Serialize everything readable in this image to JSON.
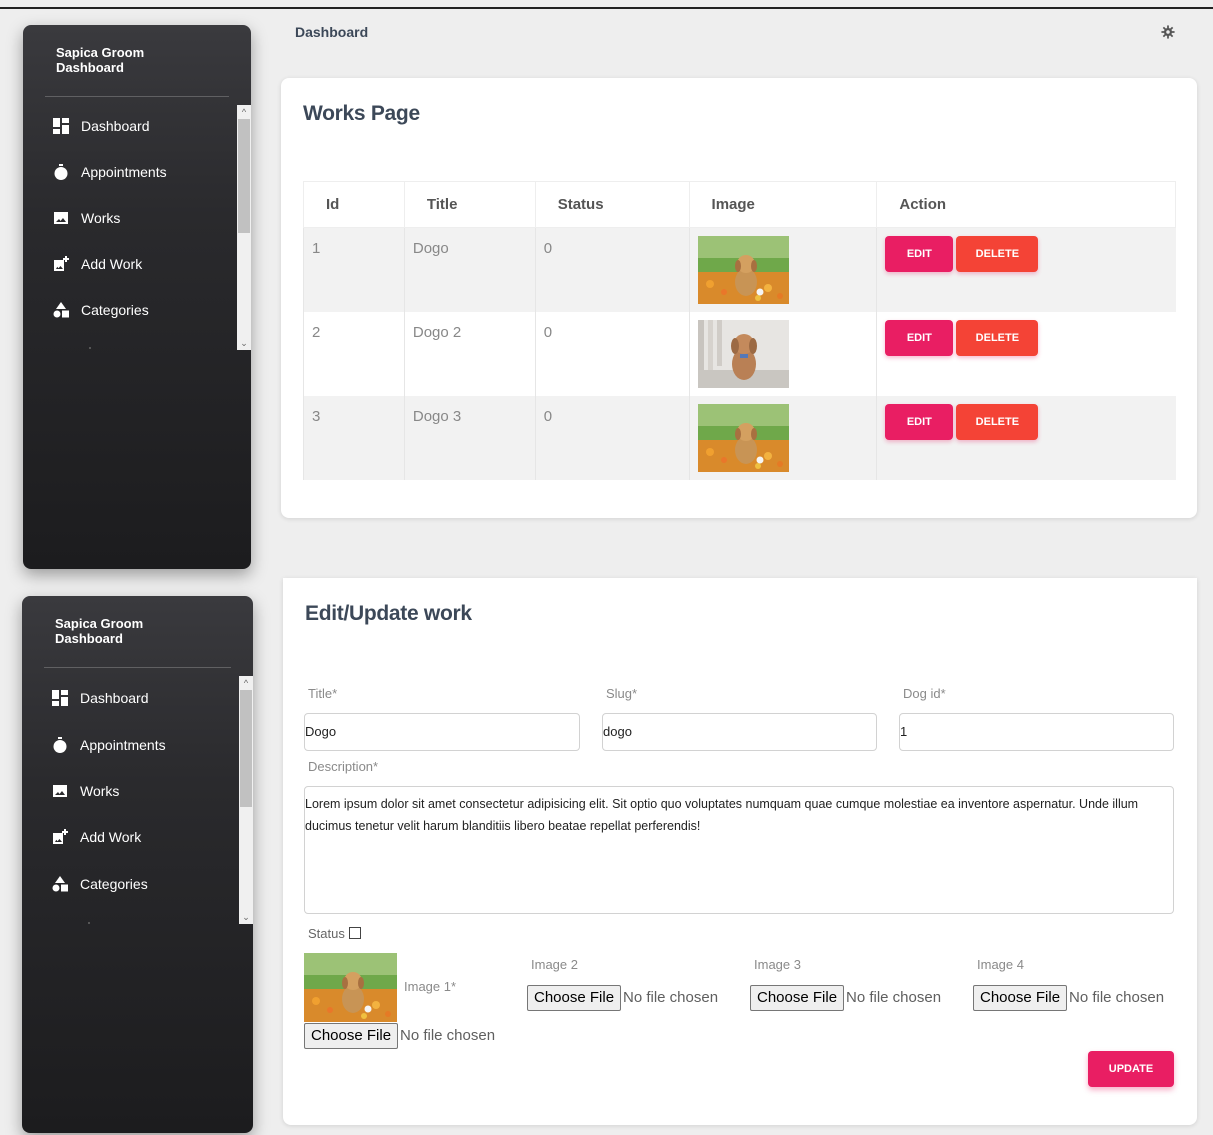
{
  "sidebar": {
    "brand_line1": "Sapica Groom",
    "brand_line2": "Dashboard",
    "items": [
      {
        "label": "Dashboard",
        "icon": "dashboard-icon"
      },
      {
        "label": "Appointments",
        "icon": "stopwatch-icon"
      },
      {
        "label": "Works",
        "icon": "image-icon"
      },
      {
        "label": "Add Work",
        "icon": "add-photo-icon"
      },
      {
        "label": "Categories",
        "icon": "category-icon"
      }
    ]
  },
  "header": {
    "title": "Dashboard",
    "settings_icon": "gear-icon"
  },
  "works_page": {
    "title": "Works Page",
    "columns": [
      "Id",
      "Title",
      "Status",
      "Image",
      "Action"
    ],
    "rows": [
      {
        "id": "1",
        "title": "Dogo",
        "status": "0",
        "image": "dog-in-field-photo"
      },
      {
        "id": "2",
        "title": "Dogo 2",
        "status": "0",
        "image": "dog-on-porch-photo"
      },
      {
        "id": "3",
        "title": "Dogo 3",
        "status": "0",
        "image": "dog-in-field-photo"
      }
    ],
    "edit_label": "EDIT",
    "delete_label": "DELETE"
  },
  "edit_form": {
    "title": "Edit/Update work",
    "title_label": "Title*",
    "title_value": "Dogo",
    "slug_label": "Slug*",
    "slug_value": "dogo",
    "dog_id_label": "Dog id*",
    "dog_id_value": "1",
    "description_label": "Description*",
    "description_value": "Lorem ipsum dolor sit amet consectetur adipisicing elit. Sit optio quo voluptates numquam quae cumque molestiae ea inventore aspernatur. Unde illum ducimus tenetur velit harum blanditiis libero beatae repellat perferendis!",
    "status_label": "Status",
    "status_checked": false,
    "image1_label": "Image 1*",
    "image2_label": "Image 2",
    "image3_label": "Image 3",
    "image4_label": "Image 4",
    "choose_file": "Choose File",
    "no_file": "No file chosen",
    "update_label": "UPDATE"
  },
  "colors": {
    "accent": "#e91e63",
    "danger": "#f44336",
    "sidebar_dark": "#1c1c1e"
  }
}
